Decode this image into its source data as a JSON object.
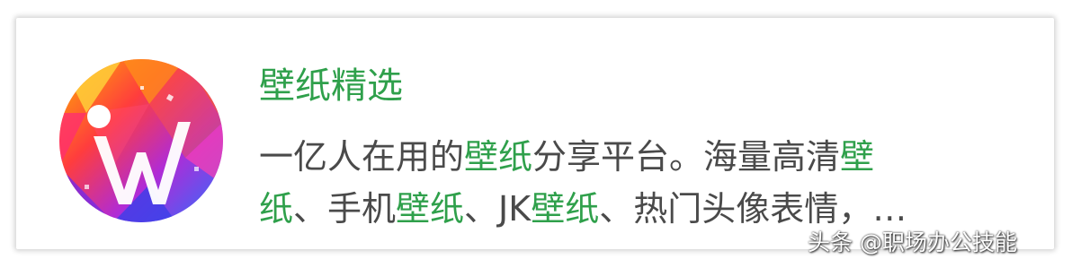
{
  "app": {
    "icon": "iw-letter-logo-icon",
    "name": "壁纸精选",
    "name_color": "#2fa04b"
  },
  "description": {
    "line1": [
      {
        "text": "一亿人在用的",
        "highlight": false
      },
      {
        "text": "壁纸",
        "highlight": true
      },
      {
        "text": "分享平台。海量高清",
        "highlight": false
      },
      {
        "text": "壁",
        "highlight": true
      }
    ],
    "line2": [
      {
        "text": "纸",
        "highlight": true
      },
      {
        "text": "、手机",
        "highlight": false
      },
      {
        "text": "壁纸",
        "highlight": true
      },
      {
        "text": "、JK",
        "highlight": false
      },
      {
        "text": "壁纸",
        "highlight": true
      },
      {
        "text": "、热门头像表情，…",
        "highlight": false
      }
    ],
    "text_color": "#4a4a4a",
    "highlight_color": "#2fa04b"
  },
  "watermark": {
    "text": "头条 @职场办公技能"
  }
}
